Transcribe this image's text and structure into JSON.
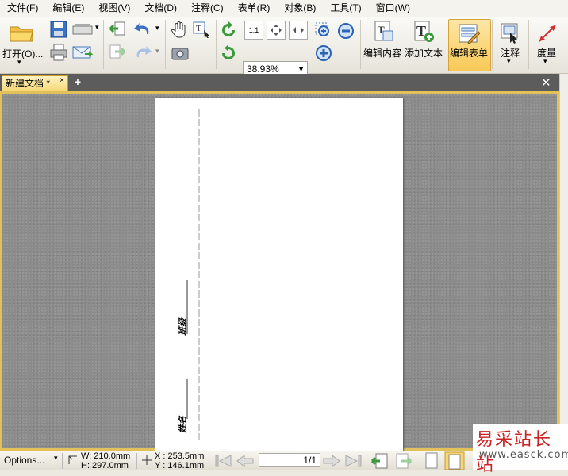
{
  "menu": [
    "文件(F)",
    "编辑(E)",
    "视图(V)",
    "文档(D)",
    "注释(C)",
    "表单(R)",
    "对象(B)",
    "工具(T)",
    "窗口(W)"
  ],
  "toolbar": {
    "open_label": "打开(O)...",
    "zoom_value": "38.93%",
    "edit_content_label": "编辑内容",
    "add_text_label": "添加文本",
    "edit_form_label": "编辑表单",
    "annotate_label": "注释",
    "measure_label": "度量"
  },
  "tab": {
    "title": "新建文档 *",
    "close": "×",
    "add": "+",
    "close_all": "✕"
  },
  "page_content": {
    "name_label": "姓名",
    "class_label": "班级"
  },
  "status": {
    "options": "Options...",
    "width": "W: 210.0mm",
    "height": "H: 297.0mm",
    "x": "X : 253.5mm",
    "y": "Y : 146.1mm",
    "page": "1/1"
  },
  "watermark": {
    "line1": "易采站长站",
    "line2": "www.easck.com"
  },
  "colors": {
    "accent": "#f8c956",
    "tab": "#f6d775",
    "canvas": "#8c8c8c",
    "watermark": "#cc2222"
  }
}
